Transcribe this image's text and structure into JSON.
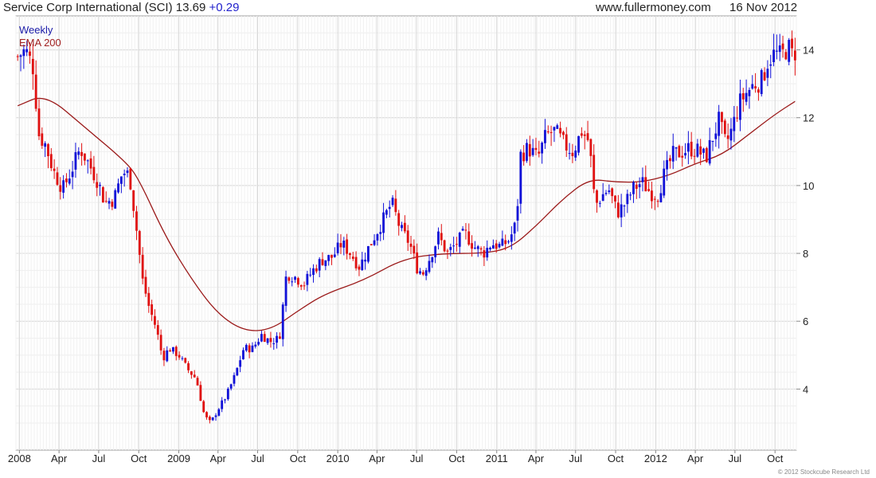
{
  "header": {
    "title": "Service Corp International (SCI)",
    "price": "13.69",
    "change": "+0.29",
    "source": "www.fullermoney.com",
    "date": "16 Nov 2012"
  },
  "legend": {
    "frequency": "Weekly",
    "indicator": "EMA 200"
  },
  "footer": {
    "copyright": "© 2012 Stockcube Research Ltd"
  },
  "colors": {
    "up_candle": "#1010d8",
    "down_candle": "#e01010",
    "ema_line": "#9b1a1a",
    "grid": "#d8d8d8"
  },
  "chart_data": {
    "type": "candlestick",
    "frequency": "weekly",
    "ylim": [
      2.2,
      15.0
    ],
    "y_ticks": [
      4,
      6,
      8,
      10,
      12,
      14
    ],
    "x_range": [
      "2007-12-24",
      "2012-11-19"
    ],
    "x_ticks": [
      {
        "label": "2008",
        "date": "2008-01-01"
      },
      {
        "label": "Apr",
        "date": "2008-04-01"
      },
      {
        "label": "Jul",
        "date": "2008-07-01"
      },
      {
        "label": "Oct",
        "date": "2008-10-01"
      },
      {
        "label": "2009",
        "date": "2009-01-01"
      },
      {
        "label": "Apr",
        "date": "2009-04-01"
      },
      {
        "label": "Jul",
        "date": "2009-07-01"
      },
      {
        "label": "Oct",
        "date": "2009-10-01"
      },
      {
        "label": "2010",
        "date": "2010-01-01"
      },
      {
        "label": "Apr",
        "date": "2010-04-01"
      },
      {
        "label": "Jul",
        "date": "2010-07-01"
      },
      {
        "label": "Oct",
        "date": "2010-10-01"
      },
      {
        "label": "2011",
        "date": "2011-01-01"
      },
      {
        "label": "Apr",
        "date": "2011-04-01"
      },
      {
        "label": "Jul",
        "date": "2011-07-01"
      },
      {
        "label": "Oct",
        "date": "2011-10-01"
      },
      {
        "label": "2012",
        "date": "2012-01-01"
      },
      {
        "label": "Apr",
        "date": "2012-04-01"
      },
      {
        "label": "Jul",
        "date": "2012-07-01"
      },
      {
        "label": "Oct",
        "date": "2012-10-01"
      }
    ],
    "close_path": [
      [
        "2007-12-28",
        13.8
      ],
      [
        "2008-01-15",
        14.0
      ],
      [
        "2008-02-01",
        13.5
      ],
      [
        "2008-02-15",
        11.5
      ],
      [
        "2008-03-01",
        11.2
      ],
      [
        "2008-03-20",
        10.4
      ],
      [
        "2008-04-10",
        9.9
      ],
      [
        "2008-05-01",
        10.5
      ],
      [
        "2008-05-20",
        11.1
      ],
      [
        "2008-06-10",
        10.6
      ],
      [
        "2008-06-30",
        10.1
      ],
      [
        "2008-07-15",
        9.5
      ],
      [
        "2008-08-05",
        9.6
      ],
      [
        "2008-08-25",
        10.4
      ],
      [
        "2008-09-10",
        10.3
      ],
      [
        "2008-09-25",
        8.8
      ],
      [
        "2008-10-10",
        7.2
      ],
      [
        "2008-10-25",
        6.4
      ],
      [
        "2008-11-10",
        5.8
      ],
      [
        "2008-11-25",
        4.9
      ],
      [
        "2008-12-10",
        5.2
      ],
      [
        "2009-01-01",
        5.0
      ],
      [
        "2009-01-20",
        4.6
      ],
      [
        "2009-02-10",
        4.3
      ],
      [
        "2009-03-01",
        3.2
      ],
      [
        "2009-03-15",
        3.0
      ],
      [
        "2009-04-01",
        3.4
      ],
      [
        "2009-04-20",
        3.8
      ],
      [
        "2009-05-10",
        4.4
      ],
      [
        "2009-05-30",
        5.2
      ],
      [
        "2009-06-20",
        5.2
      ],
      [
        "2009-07-10",
        5.6
      ],
      [
        "2009-07-30",
        5.4
      ],
      [
        "2009-08-20",
        5.5
      ],
      [
        "2009-09-05",
        7.4
      ],
      [
        "2009-09-25",
        7.3
      ],
      [
        "2009-10-15",
        7.1
      ],
      [
        "2009-11-05",
        7.5
      ],
      [
        "2009-11-25",
        7.8
      ],
      [
        "2009-12-20",
        7.9
      ],
      [
        "2010-01-10",
        8.3
      ],
      [
        "2010-01-30",
        8.0
      ],
      [
        "2010-02-20",
        7.6
      ],
      [
        "2010-03-10",
        8.1
      ],
      [
        "2010-03-30",
        8.6
      ],
      [
        "2010-04-20",
        9.1
      ],
      [
        "2010-05-05",
        9.5
      ],
      [
        "2010-05-25",
        8.7
      ],
      [
        "2010-06-15",
        8.3
      ],
      [
        "2010-07-01",
        7.6
      ],
      [
        "2010-07-15",
        7.4
      ],
      [
        "2010-08-01",
        7.9
      ],
      [
        "2010-08-20",
        8.5
      ],
      [
        "2010-09-10",
        8.0
      ],
      [
        "2010-10-01",
        8.3
      ],
      [
        "2010-10-20",
        8.6
      ],
      [
        "2010-11-10",
        8.2
      ],
      [
        "2010-12-01",
        8.0
      ],
      [
        "2010-12-20",
        8.3
      ],
      [
        "2011-01-10",
        8.2
      ],
      [
        "2011-01-30",
        8.4
      ],
      [
        "2011-02-15",
        8.9
      ],
      [
        "2011-02-25",
        10.9
      ],
      [
        "2011-03-15",
        11.1
      ],
      [
        "2011-04-05",
        10.8
      ],
      [
        "2011-04-25",
        11.5
      ],
      [
        "2011-05-15",
        11.6
      ],
      [
        "2011-06-05",
        11.2
      ],
      [
        "2011-06-25",
        11.0
      ],
      [
        "2011-07-15",
        11.6
      ],
      [
        "2011-08-01",
        11.3
      ],
      [
        "2011-08-15",
        9.4
      ],
      [
        "2011-08-30",
        9.7
      ],
      [
        "2011-09-15",
        9.9
      ],
      [
        "2011-10-05",
        9.2
      ],
      [
        "2011-10-25",
        9.5
      ],
      [
        "2011-11-10",
        9.9
      ],
      [
        "2011-11-30",
        10.1
      ],
      [
        "2011-12-20",
        9.8
      ],
      [
        "2012-01-05",
        9.7
      ],
      [
        "2012-01-20",
        10.3
      ],
      [
        "2012-02-10",
        10.9
      ],
      [
        "2012-03-01",
        11.0
      ],
      [
        "2012-03-20",
        11.1
      ],
      [
        "2012-04-10",
        11.0
      ],
      [
        "2012-04-25",
        10.8
      ],
      [
        "2012-05-10",
        11.4
      ],
      [
        "2012-05-25",
        11.9
      ],
      [
        "2012-06-10",
        11.2
      ],
      [
        "2012-06-25",
        11.7
      ],
      [
        "2012-07-10",
        12.4
      ],
      [
        "2012-07-25",
        12.7
      ],
      [
        "2012-08-15",
        13.0
      ],
      [
        "2012-09-01",
        13.1
      ],
      [
        "2012-09-15",
        13.7
      ],
      [
        "2012-10-01",
        13.9
      ],
      [
        "2012-10-15",
        13.8
      ],
      [
        "2012-10-30",
        14.1
      ],
      [
        "2012-11-16",
        13.69
      ]
    ],
    "ema_path": [
      [
        "2007-12-28",
        12.35
      ],
      [
        "2008-03-01",
        12.7
      ],
      [
        "2008-06-01",
        11.7
      ],
      [
        "2008-09-01",
        10.7
      ],
      [
        "2008-10-01",
        10.2
      ],
      [
        "2008-12-01",
        8.5
      ],
      [
        "2009-02-01",
        7.2
      ],
      [
        "2009-04-01",
        6.2
      ],
      [
        "2009-06-01",
        5.7
      ],
      [
        "2009-08-01",
        5.75
      ],
      [
        "2009-10-01",
        6.3
      ],
      [
        "2009-12-01",
        6.8
      ],
      [
        "2010-03-01",
        7.2
      ],
      [
        "2010-06-01",
        7.85
      ],
      [
        "2010-09-01",
        8.0
      ],
      [
        "2010-12-01",
        8.0
      ],
      [
        "2011-02-01",
        8.15
      ],
      [
        "2011-04-01",
        8.8
      ],
      [
        "2011-06-01",
        9.6
      ],
      [
        "2011-08-01",
        10.2
      ],
      [
        "2011-10-01",
        10.1
      ],
      [
        "2011-12-01",
        10.1
      ],
      [
        "2012-02-01",
        10.3
      ],
      [
        "2012-04-01",
        10.65
      ],
      [
        "2012-06-01",
        10.9
      ],
      [
        "2012-08-01",
        11.5
      ],
      [
        "2012-10-01",
        12.1
      ],
      [
        "2012-11-16",
        12.48
      ]
    ],
    "series": [
      {
        "name": "Weekly"
      },
      {
        "name": "EMA 200"
      }
    ]
  }
}
